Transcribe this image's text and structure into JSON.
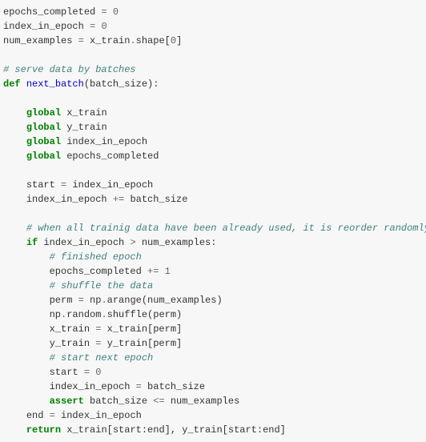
{
  "code": {
    "l1_a": "epochs_completed ",
    "l1_op": "=",
    "l1_b": " ",
    "l1_n": "0",
    "l2_a": "index_in_epoch ",
    "l2_op": "=",
    "l2_b": " ",
    "l2_n": "0",
    "l3_a": "num_examples ",
    "l3_op": "=",
    "l3_b": " x_train",
    "l3_op2": ".",
    "l3_c": "shape[",
    "l3_n": "0",
    "l3_d": "]",
    "l5_cm": "# serve data by batches",
    "l6_kw": "def",
    "l6_sp": " ",
    "l6_fn": "next_batch",
    "l6_p": "(batch_size):",
    "l8_kw": "global",
    "l8_t": " x_train",
    "l9_kw": "global",
    "l9_t": " y_train",
    "l10_kw": "global",
    "l10_t": " index_in_epoch",
    "l11_kw": "global",
    "l11_t": " epochs_completed",
    "l13_a": "start ",
    "l13_op": "=",
    "l13_b": " index_in_epoch",
    "l14_a": "index_in_epoch ",
    "l14_op": "+=",
    "l14_b": " batch_size",
    "l16_cm": "# when all trainig data have been already used, it is reorder randomly",
    "l17_kw": "if",
    "l17_a": " index_in_epoch ",
    "l17_op": ">",
    "l17_b": " num_examples:",
    "l18_cm": "# finished epoch",
    "l19_a": "epochs_completed ",
    "l19_op": "+=",
    "l19_b": " ",
    "l19_n": "1",
    "l20_cm": "# shuffle the data",
    "l21_a": "perm ",
    "l21_op": "=",
    "l21_b": " np",
    "l21_op2": ".",
    "l21_c": "arange(num_examples)",
    "l22_a": "np",
    "l22_op": ".",
    "l22_b": "random",
    "l22_op2": ".",
    "l22_c": "shuffle(perm)",
    "l23_a": "x_train ",
    "l23_op": "=",
    "l23_b": " x_train[perm]",
    "l24_a": "y_train ",
    "l24_op": "=",
    "l24_b": " y_train[perm]",
    "l25_cm": "# start next epoch",
    "l26_a": "start ",
    "l26_op": "=",
    "l26_b": " ",
    "l26_n": "0",
    "l27_a": "index_in_epoch ",
    "l27_op": "=",
    "l27_b": " batch_size",
    "l28_kw": "assert",
    "l28_a": " batch_size ",
    "l28_op": "<=",
    "l28_b": " num_examples",
    "l29_a": "end ",
    "l29_op": "=",
    "l29_b": " index_in_epoch",
    "l30_kw": "return",
    "l30_a": " x_train[start:end], y_train[start:end]"
  }
}
